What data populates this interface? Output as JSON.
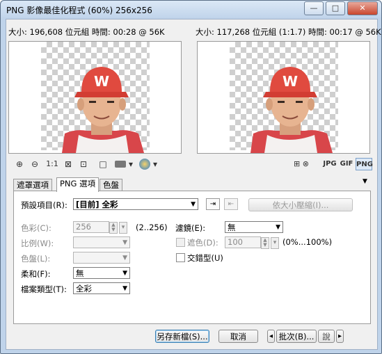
{
  "window": {
    "title": "PNG 影像最佳化程式 (60%) 256x256",
    "caption_buttons": {
      "min": "—",
      "max": "□",
      "close": "✕"
    }
  },
  "preview": {
    "left_info": "大小: 196,608 位元組 時間: 00:28 @ 56K",
    "right_info": "大小: 117,268 位元組 (1:1.7) 時間: 00:17 @ 56K"
  },
  "toolbar": {
    "zoom_in": "⊕",
    "zoom_out": "⊖",
    "actual_size": "1:1",
    "fit": "⊠",
    "crop": "⊡",
    "single_view": "□",
    "browser_dropdown": "▾",
    "jpg": "JPG",
    "gif": "GIF",
    "png": "PNG",
    "right_tools": "⊞ ⊗"
  },
  "tabs": [
    {
      "label": "遮罩選項"
    },
    {
      "label": "PNG 選項"
    },
    {
      "label": "色盤"
    }
  ],
  "tab_menu_arrow": "▼",
  "png_options": {
    "preset_label": "預設項目(R):",
    "preset_value": "[目前] 全彩",
    "size_compress_button": "依大小壓縮(I)...",
    "colors_label": "色彩(C):",
    "colors_value": "256",
    "colors_range": "(2..256)",
    "ratio_label": "比例(W):",
    "palette_label": "色盤(L):",
    "dither_label": "柔和(F):",
    "dither_value": "無",
    "filetype_label": "檔案類型(T):",
    "filetype_value": "全彩",
    "filter_label": "濾鏡(E):",
    "filter_value": "無",
    "mask_label": "遮色(D):",
    "mask_value": "100",
    "mask_range": "(0%...100%)",
    "interlace_label": "交錯型(U)"
  },
  "footer": {
    "save_as": "另存新檔(S)...",
    "cancel": "取消",
    "prev_arrow": "◂",
    "batch": "批次(B)...",
    "more": "說",
    "next_arrow": "▸"
  }
}
